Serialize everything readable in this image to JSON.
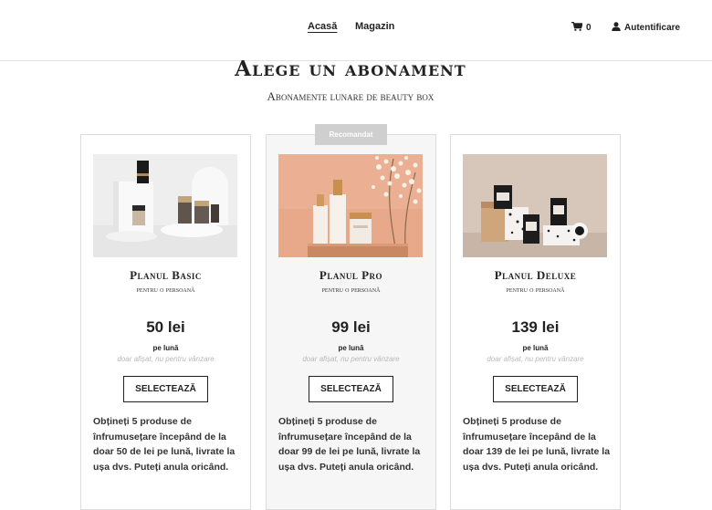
{
  "nav": {
    "links": [
      "Acasă",
      "Magazin"
    ],
    "cart_count": "0",
    "login_label": "Autentificare"
  },
  "page": {
    "heading": "Alege un abonament",
    "subheading": "Abonamente lunare de beauty box"
  },
  "plans": [
    {
      "name": "Planul Basic",
      "subtitle": "pentru o persoană",
      "price": "50 lei",
      "period": "pe lună",
      "disclaimer": "doar afișat, nu pentru vânzare",
      "button": "SELECTEAZĂ",
      "description": "Obțineți 5 produse de înfrumusețare începând de la doar 50 de lei pe lună, livrate la ușa dvs. Puteți anula oricând."
    },
    {
      "name": "Planul Pro",
      "subtitle": "pentru o persoană",
      "badge": "Recomandat",
      "price": "99 lei",
      "period": "pe lună",
      "disclaimer": "doar afișat, nu pentru vânzare",
      "button": "SELECTEAZĂ",
      "description": "Obțineți 5 produse de înfrumusețare începând de la doar 99 de lei pe lună, livrate la ușa dvs. Puteți anula oricând."
    },
    {
      "name": "Planul Deluxe",
      "subtitle": "pentru o persoană",
      "price": "139 lei",
      "period": "pe lună",
      "disclaimer": "doar afișat, nu pentru vânzare",
      "button": "SELECTEAZĂ",
      "description": "Obțineți 5 produse de înfrumusețare începând de la doar 139 de lei pe lună, livrate la ușa dvs. Puteți anula oricând."
    }
  ],
  "icons": {
    "cart": "shopping-cart-icon",
    "user": "user-icon"
  }
}
